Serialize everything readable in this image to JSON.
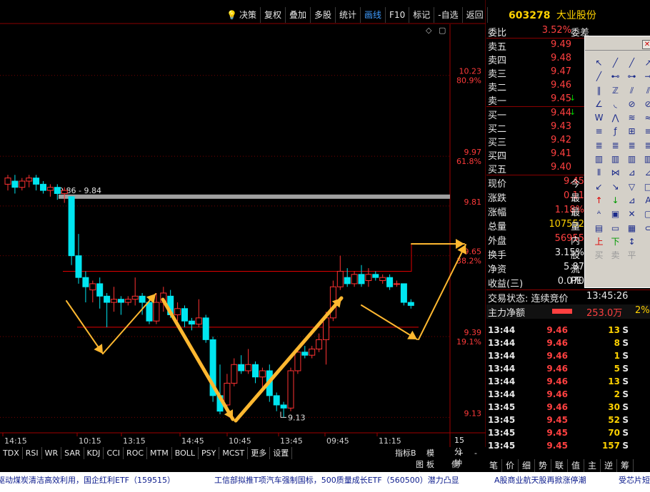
{
  "toolbar": {
    "items": [
      "决策",
      "复权",
      "叠加",
      "多股",
      "统计",
      "画线",
      "F10",
      "标记",
      "-自选",
      "返回"
    ],
    "active": "画线"
  },
  "stock": {
    "code": "603278",
    "name": "大业股份"
  },
  "order_book": {
    "weibi": {
      "label": "委比",
      "value": "3.52%",
      "label2": "委差"
    },
    "sells": [
      {
        "label": "卖五",
        "price": "9.49"
      },
      {
        "label": "卖四",
        "price": "9.48"
      },
      {
        "label": "卖三",
        "price": "9.47"
      },
      {
        "label": "卖二",
        "price": "9.46"
      },
      {
        "label": "卖一",
        "price": "9.45"
      }
    ],
    "buys": [
      {
        "label": "买一",
        "price": "9.44"
      },
      {
        "label": "买二",
        "price": "9.43"
      },
      {
        "label": "买三",
        "price": "9.42"
      },
      {
        "label": "买四",
        "price": "9.41"
      },
      {
        "label": "买五",
        "price": "9.40"
      }
    ]
  },
  "stats": [
    {
      "label": "现价",
      "value": "9.45",
      "label2": "今",
      "color": "red"
    },
    {
      "label": "涨跌",
      "value": "0.11",
      "label2": "最",
      "color": "red"
    },
    {
      "label": "涨幅",
      "value": "1.18%",
      "label2": "最",
      "color": "red"
    },
    {
      "label": "总量",
      "value": "107552",
      "label2": "量",
      "color": "yellow"
    },
    {
      "label": "外盘",
      "value": "56955",
      "label2": "内",
      "color": "red"
    },
    {
      "label": "换手",
      "value": "3.15%",
      "label2": "股",
      "color": "white"
    },
    {
      "label": "净资",
      "value": "5.87",
      "label2": "流",
      "color": "white"
    },
    {
      "label": "收益(三)",
      "value": "0.070",
      "label2": "PE",
      "color": "white"
    }
  ],
  "trade_state": {
    "label": "交易状态: 连续竞价",
    "time": "13:45:26"
  },
  "main_flow": {
    "label": "主力净额",
    "value": "253.0万",
    "pct": "2%"
  },
  "trades": [
    {
      "t": "13:44",
      "p": "9.46",
      "v": "13",
      "s": "S"
    },
    {
      "t": "13:44",
      "p": "9.46",
      "v": "8",
      "s": "S"
    },
    {
      "t": "13:44",
      "p": "9.46",
      "v": "1",
      "s": "S"
    },
    {
      "t": "13:44",
      "p": "9.46",
      "v": "5",
      "s": "S"
    },
    {
      "t": "13:44",
      "p": "9.46",
      "v": "13",
      "s": "S"
    },
    {
      "t": "13:44",
      "p": "9.46",
      "v": "2",
      "s": "S"
    },
    {
      "t": "13:45",
      "p": "9.46",
      "v": "30",
      "s": "S"
    },
    {
      "t": "13:45",
      "p": "9.45",
      "v": "52",
      "s": "S"
    },
    {
      "t": "13:45",
      "p": "9.45",
      "v": "70",
      "s": "S"
    },
    {
      "t": "13:45",
      "p": "9.45",
      "v": "157",
      "s": "S"
    }
  ],
  "indicator_tabs": [
    "TDX",
    "RSI",
    "WR",
    "SAR",
    "KDJ",
    "CCI",
    "ROC",
    "MTM",
    "BOLL",
    "PSY",
    "MCST",
    "更多",
    "设置"
  ],
  "mid_status": {
    "indicator": "指标B",
    "board": "模 板",
    "plus": "+",
    "minus": "-",
    "period": "15分钟"
  },
  "f10_bar": {
    "f10": "图文F10",
    "side": "侧边栏"
  },
  "bottom_tabs": [
    "笔",
    "价",
    "细",
    "势",
    "联",
    "值",
    "主",
    "逆",
    "筹"
  ],
  "ticker": [
    "驱动煤炭清洁高效利用，国企红利ETF（159515）",
    "工信部拟推T项汽车强制国标，500质量成长ETF（560500）潜力凸显",
    "A股商业航天股再掀涨停潮",
    "受芯片短"
  ],
  "chart_data": {
    "type": "candlestick",
    "period": "15分钟",
    "y_ticks": [
      {
        "price": "10.23",
        "pct": "80.9%"
      },
      {
        "price": "9.97",
        "pct": "61.8%"
      },
      {
        "price": "9.81",
        "pct": ""
      },
      {
        "price": "9.65",
        "pct": "38.2%"
      },
      {
        "price": "9.39",
        "pct": "19.1%"
      },
      {
        "price": "9.13",
        "pct": ""
      }
    ],
    "x_ticks": [
      "14:15",
      "10:15",
      "13:15",
      "14:45",
      "10:45",
      "13:45",
      "09:45",
      "11:15"
    ],
    "annotations": {
      "range_label": "9.86 - 9.84",
      "low_label": "9.13"
    },
    "candles": [
      {
        "o": 9.88,
        "c": 9.9,
        "h": 9.91,
        "l": 9.86
      },
      {
        "o": 9.89,
        "c": 9.87,
        "h": 9.91,
        "l": 9.85
      },
      {
        "o": 9.87,
        "c": 9.89,
        "h": 9.9,
        "l": 9.86
      },
      {
        "o": 9.89,
        "c": 9.9,
        "h": 9.91,
        "l": 9.87
      },
      {
        "o": 9.9,
        "c": 9.88,
        "h": 9.91,
        "l": 9.86
      },
      {
        "o": 9.88,
        "c": 9.86,
        "h": 9.89,
        "l": 9.85
      },
      {
        "o": 9.86,
        "c": 9.87,
        "h": 9.88,
        "l": 9.84
      },
      {
        "o": 9.87,
        "c": 9.85,
        "h": 9.88,
        "l": 9.83
      },
      {
        "o": 9.85,
        "c": 9.86,
        "h": 9.87,
        "l": 9.82
      },
      {
        "o": 9.84,
        "c": 9.65,
        "h": 9.84,
        "l": 9.62
      },
      {
        "o": 9.65,
        "c": 9.58,
        "h": 9.72,
        "l": 9.56
      },
      {
        "o": 9.58,
        "c": 9.55,
        "h": 9.6,
        "l": 9.5
      },
      {
        "o": 9.54,
        "c": 9.56,
        "h": 9.57,
        "l": 9.5
      },
      {
        "o": 9.56,
        "c": 9.52,
        "h": 9.58,
        "l": 9.48
      },
      {
        "o": 9.52,
        "c": 9.5,
        "h": 9.53,
        "l": 9.42
      },
      {
        "o": 9.5,
        "c": 9.51,
        "h": 9.55,
        "l": 9.47
      },
      {
        "o": 9.51,
        "c": 9.5,
        "h": 9.52,
        "l": 9.46
      },
      {
        "o": 9.5,
        "c": 9.51,
        "h": 9.52,
        "l": 9.49
      },
      {
        "o": 9.51,
        "c": 9.52,
        "h": 9.58,
        "l": 9.49
      },
      {
        "o": 9.52,
        "c": 9.5,
        "h": 9.53,
        "l": 9.46
      },
      {
        "o": 9.5,
        "c": 9.44,
        "h": 9.52,
        "l": 9.43
      },
      {
        "o": 9.44,
        "c": 9.5,
        "h": 9.53,
        "l": 9.43
      },
      {
        "o": 9.5,
        "c": 9.53,
        "h": 9.55,
        "l": 9.47
      },
      {
        "o": 9.52,
        "c": 9.46,
        "h": 9.54,
        "l": 9.45
      },
      {
        "o": 9.46,
        "c": 9.48,
        "h": 9.5,
        "l": 9.44
      },
      {
        "o": 9.48,
        "c": 9.44,
        "h": 9.49,
        "l": 9.42
      },
      {
        "o": 9.44,
        "c": 9.43,
        "h": 9.45,
        "l": 9.41
      },
      {
        "o": 9.43,
        "c": 9.45,
        "h": 9.51,
        "l": 9.42
      },
      {
        "o": 9.45,
        "c": 9.38,
        "h": 9.46,
        "l": 9.37
      },
      {
        "o": 9.38,
        "c": 9.2,
        "h": 9.39,
        "l": 9.18
      },
      {
        "o": 9.2,
        "c": 9.15,
        "h": 9.3,
        "l": 9.14
      },
      {
        "o": 9.17,
        "c": 9.24,
        "h": 9.27,
        "l": 9.16
      },
      {
        "o": 9.24,
        "c": 9.3,
        "h": 9.32,
        "l": 9.23
      },
      {
        "o": 9.3,
        "c": 9.28,
        "h": 9.33,
        "l": 9.27
      },
      {
        "o": 9.28,
        "c": 9.3,
        "h": 9.35,
        "l": 9.27
      },
      {
        "o": 9.3,
        "c": 9.26,
        "h": 9.31,
        "l": 9.24
      },
      {
        "o": 9.26,
        "c": 9.28,
        "h": 9.29,
        "l": 9.22
      },
      {
        "o": 9.28,
        "c": 9.2,
        "h": 9.3,
        "l": 9.18
      },
      {
        "o": 9.2,
        "c": 9.17,
        "h": 9.21,
        "l": 9.15
      },
      {
        "o": 9.17,
        "c": 9.16,
        "h": 9.18,
        "l": 9.13
      },
      {
        "o": 9.16,
        "c": 9.28,
        "h": 9.29,
        "l": 9.15
      },
      {
        "o": 9.28,
        "c": 9.34,
        "h": 9.35,
        "l": 9.27
      },
      {
        "o": 9.34,
        "c": 9.33,
        "h": 9.36,
        "l": 9.32
      },
      {
        "o": 9.33,
        "c": 9.35,
        "h": 9.36,
        "l": 9.32
      },
      {
        "o": 9.35,
        "c": 9.38,
        "h": 9.4,
        "l": 9.34
      },
      {
        "o": 9.38,
        "c": 9.45,
        "h": 9.47,
        "l": 9.3
      },
      {
        "o": 9.45,
        "c": 9.55,
        "h": 9.57,
        "l": 9.44
      },
      {
        "o": 9.55,
        "c": 9.6,
        "h": 9.65,
        "l": 9.54
      },
      {
        "o": 9.58,
        "c": 9.56,
        "h": 9.61,
        "l": 9.55
      },
      {
        "o": 9.56,
        "c": 9.59,
        "h": 9.6,
        "l": 9.55
      },
      {
        "o": 9.59,
        "c": 9.56,
        "h": 9.62,
        "l": 9.55
      },
      {
        "o": 9.57,
        "c": 9.59,
        "h": 9.61,
        "l": 9.55
      },
      {
        "o": 9.59,
        "c": 9.58,
        "h": 9.6,
        "l": 9.57
      },
      {
        "o": 9.57,
        "c": 9.58,
        "h": 9.59,
        "l": 9.56
      },
      {
        "o": 9.58,
        "c": 9.55,
        "h": 9.59,
        "l": 9.54
      },
      {
        "o": 9.56,
        "c": 9.56,
        "h": 9.57,
        "l": 9.55
      },
      {
        "o": 9.56,
        "c": 9.5,
        "h": 9.56,
        "l": 9.49
      },
      {
        "o": 9.5,
        "c": 9.49,
        "h": 9.51,
        "l": 9.48
      }
    ],
    "lines": {
      "resistance_top": 9.84,
      "channel_upper": 9.6,
      "channel_lower": 9.42
    }
  }
}
